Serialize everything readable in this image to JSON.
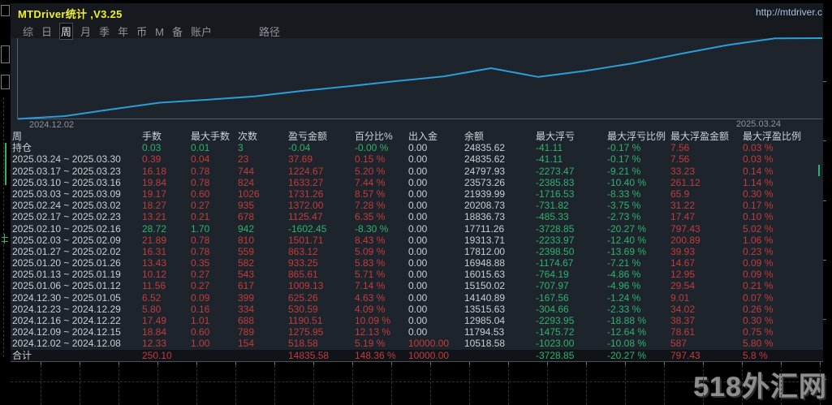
{
  "window": {
    "title": "MTDriver统计 ,V3.25",
    "link": "http://mtdriver.c",
    "watermark": "518外汇网"
  },
  "tabs": {
    "items": [
      "综",
      "日",
      "周",
      "月",
      "季",
      "年",
      "币",
      "M",
      "备",
      "账户"
    ],
    "selected": "周",
    "path_label": "路径"
  },
  "palette": {
    "profit_red": "#c23c3c",
    "loss_green": "#2eb26d",
    "neutral_white": "#c9ced4",
    "title_yellow": "#f0f033",
    "line_blue": "#2d9dd8"
  },
  "chart_data": {
    "type": "line",
    "title": "",
    "xlabel": "",
    "ylabel": "",
    "x_start_label": "2024.12.02",
    "x_end_label": "2025.03.24",
    "x": [
      "2024.12.02",
      "2024.12.08",
      "2024.12.15",
      "2024.12.22",
      "2024.12.29",
      "2025.01.05",
      "2025.01.12",
      "2025.01.19",
      "2025.01.26",
      "2025.02.02",
      "2025.02.09",
      "2025.02.16",
      "2025.02.23",
      "2025.03.02",
      "2025.03.09",
      "2025.03.16",
      "2025.03.23",
      "2025.03.30"
    ],
    "series": [
      {
        "name": "余额",
        "values": [
          10000,
          10518.58,
          11794.53,
          12985.04,
          13515.63,
          14140.89,
          15150.02,
          16015.63,
          16948.88,
          17812.0,
          19313.71,
          17711.26,
          18836.73,
          20208.73,
          21939.99,
          23573.26,
          24797.93,
          24835.62
        ]
      }
    ],
    "ylim": [
      10000,
      24836
    ],
    "grid": false,
    "legend": false,
    "line_color": "#2d9dd8"
  },
  "table": {
    "headers": [
      "周",
      "手数",
      "最大手数",
      "次数",
      "盈亏金额",
      "百分比%",
      "出入金",
      "余额",
      "最大浮亏",
      "最大浮亏比例",
      "最大浮盈金额",
      "最大浮盈比例"
    ],
    "rows": [
      {
        "label": "持仓",
        "cells": [
          "0.03",
          "0.01",
          "3",
          "-0.04",
          "-0.00 %",
          "0.00",
          "24835.62",
          "-41.11",
          "-0.17 %",
          "7.56",
          "0.03 %"
        ],
        "colors": [
          "g",
          "g",
          "g",
          "g",
          "g",
          "w",
          "w",
          "g",
          "g",
          "r",
          "r"
        ]
      },
      {
        "label": "2025.03.24 ~ 2025.03.30",
        "cells": [
          "0.39",
          "0.04",
          "23",
          "37.69",
          "0.15 %",
          "0.00",
          "24835.62",
          "-41.11",
          "-0.17 %",
          "7.56",
          "0.03 %"
        ],
        "colors": [
          "r",
          "r",
          "r",
          "r",
          "r",
          "w",
          "w",
          "g",
          "g",
          "r",
          "r"
        ]
      },
      {
        "label": "2025.03.17 ~ 2025.03.23",
        "cells": [
          "16.18",
          "0.78",
          "744",
          "1224.67",
          "5.20 %",
          "0.00",
          "24797.93",
          "-2273.47",
          "-9.21 %",
          "33.23",
          "0.14 %"
        ],
        "colors": [
          "r",
          "r",
          "r",
          "r",
          "r",
          "w",
          "w",
          "g",
          "g",
          "r",
          "r"
        ]
      },
      {
        "label": "2025.03.10 ~ 2025.03.16",
        "cells": [
          "19.84",
          "0.78",
          "824",
          "1633.27",
          "7.44 %",
          "0.00",
          "23573.26",
          "-2385.83",
          "-10.40 %",
          "261.12",
          "1.14 %"
        ],
        "colors": [
          "r",
          "r",
          "r",
          "r",
          "r",
          "w",
          "w",
          "g",
          "g",
          "r",
          "r"
        ]
      },
      {
        "label": "2025.03.03 ~ 2025.03.09",
        "cells": [
          "19.17",
          "0.60",
          "1026",
          "1731.26",
          "8.57 %",
          "0.00",
          "21939.99",
          "-1716.53",
          "-8.33 %",
          "65.9",
          "0.30 %"
        ],
        "colors": [
          "r",
          "r",
          "r",
          "r",
          "r",
          "w",
          "w",
          "g",
          "g",
          "r",
          "r"
        ]
      },
      {
        "label": "2025.02.24 ~ 2025.03.02",
        "cells": [
          "18.27",
          "0.27",
          "935",
          "1372.00",
          "7.28 %",
          "0.00",
          "20208.73",
          "-731.82",
          "-3.75 %",
          "31.22",
          "0.17 %"
        ],
        "colors": [
          "r",
          "r",
          "r",
          "r",
          "r",
          "w",
          "w",
          "g",
          "g",
          "r",
          "r"
        ]
      },
      {
        "label": "2025.02.17 ~ 2025.02.23",
        "cells": [
          "13.21",
          "0.21",
          "678",
          "1125.47",
          "6.35 %",
          "0.00",
          "18836.73",
          "-485.33",
          "-2.73 %",
          "17.47",
          "0.10 %"
        ],
        "colors": [
          "r",
          "r",
          "r",
          "r",
          "r",
          "w",
          "w",
          "g",
          "g",
          "r",
          "r"
        ]
      },
      {
        "label": "2025.02.10 ~ 2025.02.16",
        "cells": [
          "28.72",
          "1.70",
          "942",
          "-1602.45",
          "-8.30 %",
          "0.00",
          "17711.26",
          "-3728.85",
          "-20.27 %",
          "797.43",
          "5.02 %"
        ],
        "colors": [
          "g",
          "g",
          "g",
          "g",
          "g",
          "w",
          "w",
          "g",
          "g",
          "r",
          "r"
        ]
      },
      {
        "label": "2025.02.03 ~ 2025.02.09",
        "cells": [
          "21.89",
          "0.78",
          "810",
          "1501.71",
          "8.43 %",
          "0.00",
          "19313.71",
          "-2233.97",
          "-12.40 %",
          "200.89",
          "1.06 %"
        ],
        "colors": [
          "r",
          "r",
          "r",
          "r",
          "r",
          "w",
          "w",
          "g",
          "g",
          "r",
          "r"
        ]
      },
      {
        "label": "2025.01.27 ~ 2025.02.02",
        "cells": [
          "16.31",
          "0.78",
          "559",
          "863.12",
          "5.09 %",
          "0.00",
          "17812.00",
          "-2398.50",
          "-13.69 %",
          "39.93",
          "0.23 %"
        ],
        "colors": [
          "r",
          "r",
          "r",
          "r",
          "r",
          "w",
          "w",
          "g",
          "g",
          "r",
          "r"
        ]
      },
      {
        "label": "2025.01.20 ~ 2025.01.26",
        "cells": [
          "13.43",
          "0.35",
          "582",
          "933.25",
          "5.83 %",
          "0.00",
          "16948.88",
          "-1174.67",
          "-7.21 %",
          "14.67",
          "0.09 %"
        ],
        "colors": [
          "r",
          "r",
          "r",
          "r",
          "r",
          "w",
          "w",
          "g",
          "g",
          "r",
          "r"
        ]
      },
      {
        "label": "2025.01.13 ~ 2025.01.19",
        "cells": [
          "10.12",
          "0.27",
          "543",
          "865.61",
          "5.71 %",
          "0.00",
          "16015.63",
          "-764.19",
          "-4.86 %",
          "12.95",
          "0.09 %"
        ],
        "colors": [
          "r",
          "r",
          "r",
          "r",
          "r",
          "w",
          "w",
          "g",
          "g",
          "r",
          "r"
        ]
      },
      {
        "label": "2025.01.06 ~ 2025.01.12",
        "cells": [
          "11.56",
          "0.27",
          "617",
          "1009.13",
          "7.14 %",
          "0.00",
          "15150.02",
          "-707.97",
          "-4.96 %",
          "29.54",
          "0.21 %"
        ],
        "colors": [
          "r",
          "r",
          "r",
          "r",
          "r",
          "w",
          "w",
          "g",
          "g",
          "r",
          "r"
        ]
      },
      {
        "label": "2024.12.30 ~ 2025.01.05",
        "cells": [
          "6.52",
          "0.09",
          "399",
          "625.26",
          "4.63 %",
          "0.00",
          "14140.89",
          "-167.56",
          "-1.24 %",
          "9.01",
          "0.07 %"
        ],
        "colors": [
          "r",
          "r",
          "r",
          "r",
          "r",
          "w",
          "w",
          "g",
          "g",
          "r",
          "r"
        ]
      },
      {
        "label": "2024.12.23 ~ 2024.12.29",
        "cells": [
          "5.80",
          "0.16",
          "334",
          "530.59",
          "4.09 %",
          "0.00",
          "13515.63",
          "-304.66",
          "-2.33 %",
          "34.02",
          "0.26 %"
        ],
        "colors": [
          "r",
          "r",
          "r",
          "r",
          "r",
          "w",
          "w",
          "g",
          "g",
          "r",
          "r"
        ]
      },
      {
        "label": "2024.12.16 ~ 2024.12.22",
        "cells": [
          "17.49",
          "1.01",
          "688",
          "1190.51",
          "10.09 %",
          "0.00",
          "12985.04",
          "-2293.95",
          "-18.88 %",
          "38.37",
          "0.30 %"
        ],
        "colors": [
          "r",
          "r",
          "r",
          "r",
          "r",
          "w",
          "w",
          "g",
          "g",
          "r",
          "r"
        ]
      },
      {
        "label": "2024.12.09 ~ 2024.12.15",
        "cells": [
          "18.84",
          "0.60",
          "789",
          "1275.95",
          "12.13 %",
          "0.00",
          "11794.53",
          "-1475.72",
          "-12.64 %",
          "78.61",
          "0.75 %"
        ],
        "colors": [
          "r",
          "r",
          "r",
          "r",
          "r",
          "w",
          "w",
          "g",
          "g",
          "r",
          "r"
        ]
      },
      {
        "label": "2024.12.02 ~ 2024.12.08",
        "cells": [
          "12.33",
          "1.00",
          "154",
          "518.58",
          "5.19 %",
          "10000.00",
          "10518.58",
          "-1023.00",
          "-10.08 %",
          "587",
          "5.80 %"
        ],
        "colors": [
          "r",
          "r",
          "r",
          "r",
          "r",
          "r",
          "w",
          "g",
          "g",
          "r",
          "r"
        ]
      },
      {
        "label": "合计",
        "total": true,
        "cells": [
          "250.10",
          "",
          "",
          "14835.58",
          "148.36 %",
          "10000.00",
          "",
          "-3728.85",
          "-20.27 %",
          "797.43",
          "5.8 %"
        ],
        "colors": [
          "r",
          "w",
          "w",
          "r",
          "r",
          "r",
          "w",
          "g",
          "g",
          "r",
          "r"
        ]
      }
    ]
  }
}
